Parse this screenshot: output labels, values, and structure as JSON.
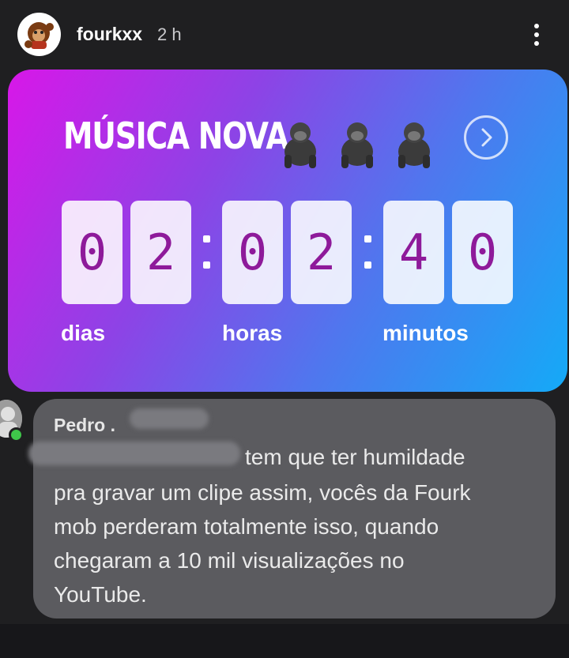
{
  "header": {
    "username": "fourkxx",
    "time": "2 h"
  },
  "sticker": {
    "title": "MÚSICA NOVA",
    "digits": [
      "0",
      "2",
      "0",
      "2",
      "4",
      "0"
    ],
    "units": [
      "dias",
      "horas",
      "minutos"
    ],
    "colors": {
      "gradient_start": "#d817e8",
      "gradient_end": "#14aaf7",
      "digit": "#8e1a9a"
    }
  },
  "comment": {
    "author": "Pedro .",
    "first_line": "tem que ter humildade",
    "lines": [
      "pra gravar um clipe assim, vocês da Fourk",
      "mob perderam totalmente isso, quando",
      "chegaram a 10 mil visualizações no",
      "YouTube."
    ]
  }
}
